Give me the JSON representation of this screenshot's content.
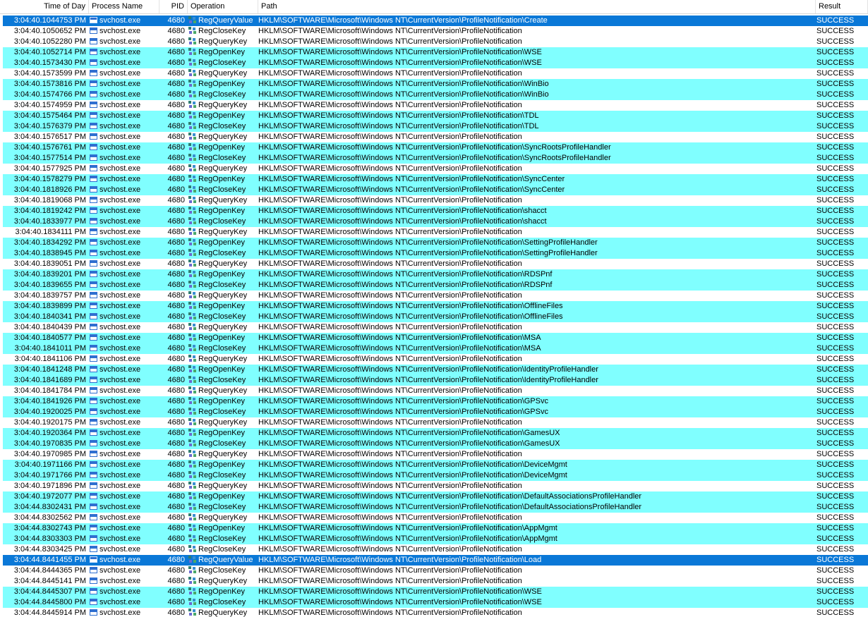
{
  "columns": [
    "Time of Day",
    "Process Name",
    "PID",
    "Operation",
    "Path",
    "Result"
  ],
  "rows": [
    {
      "time": "3:04:40.1044753 PM",
      "proc": "svchost.exe",
      "pid": "4680",
      "op": "RegQueryValue",
      "path": "HKLM\\SOFTWARE\\Microsoft\\Windows NT\\CurrentVersion\\ProfileNotification\\Create",
      "result": "SUCCESS",
      "style": "sel"
    },
    {
      "time": "3:04:40.1050652 PM",
      "proc": "svchost.exe",
      "pid": "4680",
      "op": "RegCloseKey",
      "path": "HKLM\\SOFTWARE\\Microsoft\\Windows NT\\CurrentVersion\\ProfileNotification",
      "result": "SUCCESS",
      "style": "white"
    },
    {
      "time": "3:04:40.1052280 PM",
      "proc": "svchost.exe",
      "pid": "4680",
      "op": "RegQueryKey",
      "path": "HKLM\\SOFTWARE\\Microsoft\\Windows NT\\CurrentVersion\\ProfileNotification",
      "result": "SUCCESS",
      "style": "white"
    },
    {
      "time": "3:04:40.1052714 PM",
      "proc": "svchost.exe",
      "pid": "4680",
      "op": "RegOpenKey",
      "path": "HKLM\\SOFTWARE\\Microsoft\\Windows NT\\CurrentVersion\\ProfileNotification\\WSE",
      "result": "SUCCESS",
      "style": "alt"
    },
    {
      "time": "3:04:40.1573430 PM",
      "proc": "svchost.exe",
      "pid": "4680",
      "op": "RegCloseKey",
      "path": "HKLM\\SOFTWARE\\Microsoft\\Windows NT\\CurrentVersion\\ProfileNotification\\WSE",
      "result": "SUCCESS",
      "style": "alt"
    },
    {
      "time": "3:04:40.1573599 PM",
      "proc": "svchost.exe",
      "pid": "4680",
      "op": "RegQueryKey",
      "path": "HKLM\\SOFTWARE\\Microsoft\\Windows NT\\CurrentVersion\\ProfileNotification",
      "result": "SUCCESS",
      "style": "white"
    },
    {
      "time": "3:04:40.1573816 PM",
      "proc": "svchost.exe",
      "pid": "4680",
      "op": "RegOpenKey",
      "path": "HKLM\\SOFTWARE\\Microsoft\\Windows NT\\CurrentVersion\\ProfileNotification\\WinBio",
      "result": "SUCCESS",
      "style": "alt"
    },
    {
      "time": "3:04:40.1574766 PM",
      "proc": "svchost.exe",
      "pid": "4680",
      "op": "RegCloseKey",
      "path": "HKLM\\SOFTWARE\\Microsoft\\Windows NT\\CurrentVersion\\ProfileNotification\\WinBio",
      "result": "SUCCESS",
      "style": "alt"
    },
    {
      "time": "3:04:40.1574959 PM",
      "proc": "svchost.exe",
      "pid": "4680",
      "op": "RegQueryKey",
      "path": "HKLM\\SOFTWARE\\Microsoft\\Windows NT\\CurrentVersion\\ProfileNotification",
      "result": "SUCCESS",
      "style": "white"
    },
    {
      "time": "3:04:40.1575464 PM",
      "proc": "svchost.exe",
      "pid": "4680",
      "op": "RegOpenKey",
      "path": "HKLM\\SOFTWARE\\Microsoft\\Windows NT\\CurrentVersion\\ProfileNotification\\TDL",
      "result": "SUCCESS",
      "style": "alt"
    },
    {
      "time": "3:04:40.1576379 PM",
      "proc": "svchost.exe",
      "pid": "4680",
      "op": "RegCloseKey",
      "path": "HKLM\\SOFTWARE\\Microsoft\\Windows NT\\CurrentVersion\\ProfileNotification\\TDL",
      "result": "SUCCESS",
      "style": "alt"
    },
    {
      "time": "3:04:40.1576517 PM",
      "proc": "svchost.exe",
      "pid": "4680",
      "op": "RegQueryKey",
      "path": "HKLM\\SOFTWARE\\Microsoft\\Windows NT\\CurrentVersion\\ProfileNotification",
      "result": "SUCCESS",
      "style": "white"
    },
    {
      "time": "3:04:40.1576761 PM",
      "proc": "svchost.exe",
      "pid": "4680",
      "op": "RegOpenKey",
      "path": "HKLM\\SOFTWARE\\Microsoft\\Windows NT\\CurrentVersion\\ProfileNotification\\SyncRootsProfileHandler",
      "result": "SUCCESS",
      "style": "alt"
    },
    {
      "time": "3:04:40.1577514 PM",
      "proc": "svchost.exe",
      "pid": "4680",
      "op": "RegCloseKey",
      "path": "HKLM\\SOFTWARE\\Microsoft\\Windows NT\\CurrentVersion\\ProfileNotification\\SyncRootsProfileHandler",
      "result": "SUCCESS",
      "style": "alt"
    },
    {
      "time": "3:04:40.1577925 PM",
      "proc": "svchost.exe",
      "pid": "4680",
      "op": "RegQueryKey",
      "path": "HKLM\\SOFTWARE\\Microsoft\\Windows NT\\CurrentVersion\\ProfileNotification",
      "result": "SUCCESS",
      "style": "white"
    },
    {
      "time": "3:04:40.1578279 PM",
      "proc": "svchost.exe",
      "pid": "4680",
      "op": "RegOpenKey",
      "path": "HKLM\\SOFTWARE\\Microsoft\\Windows NT\\CurrentVersion\\ProfileNotification\\SyncCenter",
      "result": "SUCCESS",
      "style": "alt"
    },
    {
      "time": "3:04:40.1818926 PM",
      "proc": "svchost.exe",
      "pid": "4680",
      "op": "RegCloseKey",
      "path": "HKLM\\SOFTWARE\\Microsoft\\Windows NT\\CurrentVersion\\ProfileNotification\\SyncCenter",
      "result": "SUCCESS",
      "style": "alt"
    },
    {
      "time": "3:04:40.1819068 PM",
      "proc": "svchost.exe",
      "pid": "4680",
      "op": "RegQueryKey",
      "path": "HKLM\\SOFTWARE\\Microsoft\\Windows NT\\CurrentVersion\\ProfileNotification",
      "result": "SUCCESS",
      "style": "white"
    },
    {
      "time": "3:04:40.1819242 PM",
      "proc": "svchost.exe",
      "pid": "4680",
      "op": "RegOpenKey",
      "path": "HKLM\\SOFTWARE\\Microsoft\\Windows NT\\CurrentVersion\\ProfileNotification\\shacct",
      "result": "SUCCESS",
      "style": "alt"
    },
    {
      "time": "3:04:40.1833977 PM",
      "proc": "svchost.exe",
      "pid": "4680",
      "op": "RegCloseKey",
      "path": "HKLM\\SOFTWARE\\Microsoft\\Windows NT\\CurrentVersion\\ProfileNotification\\shacct",
      "result": "SUCCESS",
      "style": "alt"
    },
    {
      "time": "3:04:40.1834111 PM",
      "proc": "svchost.exe",
      "pid": "4680",
      "op": "RegQueryKey",
      "path": "HKLM\\SOFTWARE\\Microsoft\\Windows NT\\CurrentVersion\\ProfileNotification",
      "result": "SUCCESS",
      "style": "white"
    },
    {
      "time": "3:04:40.1834292 PM",
      "proc": "svchost.exe",
      "pid": "4680",
      "op": "RegOpenKey",
      "path": "HKLM\\SOFTWARE\\Microsoft\\Windows NT\\CurrentVersion\\ProfileNotification\\SettingProfileHandler",
      "result": "SUCCESS",
      "style": "alt"
    },
    {
      "time": "3:04:40.1838945 PM",
      "proc": "svchost.exe",
      "pid": "4680",
      "op": "RegCloseKey",
      "path": "HKLM\\SOFTWARE\\Microsoft\\Windows NT\\CurrentVersion\\ProfileNotification\\SettingProfileHandler",
      "result": "SUCCESS",
      "style": "alt"
    },
    {
      "time": "3:04:40.1839051 PM",
      "proc": "svchost.exe",
      "pid": "4680",
      "op": "RegQueryKey",
      "path": "HKLM\\SOFTWARE\\Microsoft\\Windows NT\\CurrentVersion\\ProfileNotification",
      "result": "SUCCESS",
      "style": "white"
    },
    {
      "time": "3:04:40.1839201 PM",
      "proc": "svchost.exe",
      "pid": "4680",
      "op": "RegOpenKey",
      "path": "HKLM\\SOFTWARE\\Microsoft\\Windows NT\\CurrentVersion\\ProfileNotification\\RDSPnf",
      "result": "SUCCESS",
      "style": "alt"
    },
    {
      "time": "3:04:40.1839655 PM",
      "proc": "svchost.exe",
      "pid": "4680",
      "op": "RegCloseKey",
      "path": "HKLM\\SOFTWARE\\Microsoft\\Windows NT\\CurrentVersion\\ProfileNotification\\RDSPnf",
      "result": "SUCCESS",
      "style": "alt"
    },
    {
      "time": "3:04:40.1839757 PM",
      "proc": "svchost.exe",
      "pid": "4680",
      "op": "RegQueryKey",
      "path": "HKLM\\SOFTWARE\\Microsoft\\Windows NT\\CurrentVersion\\ProfileNotification",
      "result": "SUCCESS",
      "style": "white"
    },
    {
      "time": "3:04:40.1839899 PM",
      "proc": "svchost.exe",
      "pid": "4680",
      "op": "RegOpenKey",
      "path": "HKLM\\SOFTWARE\\Microsoft\\Windows NT\\CurrentVersion\\ProfileNotification\\OfflineFiles",
      "result": "SUCCESS",
      "style": "alt"
    },
    {
      "time": "3:04:40.1840341 PM",
      "proc": "svchost.exe",
      "pid": "4680",
      "op": "RegCloseKey",
      "path": "HKLM\\SOFTWARE\\Microsoft\\Windows NT\\CurrentVersion\\ProfileNotification\\OfflineFiles",
      "result": "SUCCESS",
      "style": "alt"
    },
    {
      "time": "3:04:40.1840439 PM",
      "proc": "svchost.exe",
      "pid": "4680",
      "op": "RegQueryKey",
      "path": "HKLM\\SOFTWARE\\Microsoft\\Windows NT\\CurrentVersion\\ProfileNotification",
      "result": "SUCCESS",
      "style": "white"
    },
    {
      "time": "3:04:40.1840577 PM",
      "proc": "svchost.exe",
      "pid": "4680",
      "op": "RegOpenKey",
      "path": "HKLM\\SOFTWARE\\Microsoft\\Windows NT\\CurrentVersion\\ProfileNotification\\MSA",
      "result": "SUCCESS",
      "style": "alt"
    },
    {
      "time": "3:04:40.1841011 PM",
      "proc": "svchost.exe",
      "pid": "4680",
      "op": "RegCloseKey",
      "path": "HKLM\\SOFTWARE\\Microsoft\\Windows NT\\CurrentVersion\\ProfileNotification\\MSA",
      "result": "SUCCESS",
      "style": "alt"
    },
    {
      "time": "3:04:40.1841106 PM",
      "proc": "svchost.exe",
      "pid": "4680",
      "op": "RegQueryKey",
      "path": "HKLM\\SOFTWARE\\Microsoft\\Windows NT\\CurrentVersion\\ProfileNotification",
      "result": "SUCCESS",
      "style": "white"
    },
    {
      "time": "3:04:40.1841248 PM",
      "proc": "svchost.exe",
      "pid": "4680",
      "op": "RegOpenKey",
      "path": "HKLM\\SOFTWARE\\Microsoft\\Windows NT\\CurrentVersion\\ProfileNotification\\IdentityProfileHandler",
      "result": "SUCCESS",
      "style": "alt"
    },
    {
      "time": "3:04:40.1841689 PM",
      "proc": "svchost.exe",
      "pid": "4680",
      "op": "RegCloseKey",
      "path": "HKLM\\SOFTWARE\\Microsoft\\Windows NT\\CurrentVersion\\ProfileNotification\\IdentityProfileHandler",
      "result": "SUCCESS",
      "style": "alt"
    },
    {
      "time": "3:04:40.1841784 PM",
      "proc": "svchost.exe",
      "pid": "4680",
      "op": "RegQueryKey",
      "path": "HKLM\\SOFTWARE\\Microsoft\\Windows NT\\CurrentVersion\\ProfileNotification",
      "result": "SUCCESS",
      "style": "white"
    },
    {
      "time": "3:04:40.1841926 PM",
      "proc": "svchost.exe",
      "pid": "4680",
      "op": "RegOpenKey",
      "path": "HKLM\\SOFTWARE\\Microsoft\\Windows NT\\CurrentVersion\\ProfileNotification\\GPSvc",
      "result": "SUCCESS",
      "style": "alt"
    },
    {
      "time": "3:04:40.1920025 PM",
      "proc": "svchost.exe",
      "pid": "4680",
      "op": "RegCloseKey",
      "path": "HKLM\\SOFTWARE\\Microsoft\\Windows NT\\CurrentVersion\\ProfileNotification\\GPSvc",
      "result": "SUCCESS",
      "style": "alt"
    },
    {
      "time": "3:04:40.1920175 PM",
      "proc": "svchost.exe",
      "pid": "4680",
      "op": "RegQueryKey",
      "path": "HKLM\\SOFTWARE\\Microsoft\\Windows NT\\CurrentVersion\\ProfileNotification",
      "result": "SUCCESS",
      "style": "white"
    },
    {
      "time": "3:04:40.1920364 PM",
      "proc": "svchost.exe",
      "pid": "4680",
      "op": "RegOpenKey",
      "path": "HKLM\\SOFTWARE\\Microsoft\\Windows NT\\CurrentVersion\\ProfileNotification\\GamesUX",
      "result": "SUCCESS",
      "style": "alt"
    },
    {
      "time": "3:04:40.1970835 PM",
      "proc": "svchost.exe",
      "pid": "4680",
      "op": "RegCloseKey",
      "path": "HKLM\\SOFTWARE\\Microsoft\\Windows NT\\CurrentVersion\\ProfileNotification\\GamesUX",
      "result": "SUCCESS",
      "style": "alt"
    },
    {
      "time": "3:04:40.1970985 PM",
      "proc": "svchost.exe",
      "pid": "4680",
      "op": "RegQueryKey",
      "path": "HKLM\\SOFTWARE\\Microsoft\\Windows NT\\CurrentVersion\\ProfileNotification",
      "result": "SUCCESS",
      "style": "white"
    },
    {
      "time": "3:04:40.1971166 PM",
      "proc": "svchost.exe",
      "pid": "4680",
      "op": "RegOpenKey",
      "path": "HKLM\\SOFTWARE\\Microsoft\\Windows NT\\CurrentVersion\\ProfileNotification\\DeviceMgmt",
      "result": "SUCCESS",
      "style": "alt"
    },
    {
      "time": "3:04:40.1971766 PM",
      "proc": "svchost.exe",
      "pid": "4680",
      "op": "RegCloseKey",
      "path": "HKLM\\SOFTWARE\\Microsoft\\Windows NT\\CurrentVersion\\ProfileNotification\\DeviceMgmt",
      "result": "SUCCESS",
      "style": "alt"
    },
    {
      "time": "3:04:40.1971896 PM",
      "proc": "svchost.exe",
      "pid": "4680",
      "op": "RegQueryKey",
      "path": "HKLM\\SOFTWARE\\Microsoft\\Windows NT\\CurrentVersion\\ProfileNotification",
      "result": "SUCCESS",
      "style": "white"
    },
    {
      "time": "3:04:40.1972077 PM",
      "proc": "svchost.exe",
      "pid": "4680",
      "op": "RegOpenKey",
      "path": "HKLM\\SOFTWARE\\Microsoft\\Windows NT\\CurrentVersion\\ProfileNotification\\DefaultAssociationsProfileHandler",
      "result": "SUCCESS",
      "style": "alt"
    },
    {
      "time": "3:04:44.8302431 PM",
      "proc": "svchost.exe",
      "pid": "4680",
      "op": "RegCloseKey",
      "path": "HKLM\\SOFTWARE\\Microsoft\\Windows NT\\CurrentVersion\\ProfileNotification\\DefaultAssociationsProfileHandler",
      "result": "SUCCESS",
      "style": "alt"
    },
    {
      "time": "3:04:44.8302562 PM",
      "proc": "svchost.exe",
      "pid": "4680",
      "op": "RegQueryKey",
      "path": "HKLM\\SOFTWARE\\Microsoft\\Windows NT\\CurrentVersion\\ProfileNotification",
      "result": "SUCCESS",
      "style": "white"
    },
    {
      "time": "3:04:44.8302743 PM",
      "proc": "svchost.exe",
      "pid": "4680",
      "op": "RegOpenKey",
      "path": "HKLM\\SOFTWARE\\Microsoft\\Windows NT\\CurrentVersion\\ProfileNotification\\AppMgmt",
      "result": "SUCCESS",
      "style": "alt"
    },
    {
      "time": "3:04:44.8303303 PM",
      "proc": "svchost.exe",
      "pid": "4680",
      "op": "RegCloseKey",
      "path": "HKLM\\SOFTWARE\\Microsoft\\Windows NT\\CurrentVersion\\ProfileNotification\\AppMgmt",
      "result": "SUCCESS",
      "style": "alt"
    },
    {
      "time": "3:04:44.8303425 PM",
      "proc": "svchost.exe",
      "pid": "4680",
      "op": "RegCloseKey",
      "path": "HKLM\\SOFTWARE\\Microsoft\\Windows NT\\CurrentVersion\\ProfileNotification",
      "result": "SUCCESS",
      "style": "white"
    },
    {
      "time": "3:04:44.8441455 PM",
      "proc": "svchost.exe",
      "pid": "4680",
      "op": "RegQueryValue",
      "path": "HKLM\\SOFTWARE\\Microsoft\\Windows NT\\CurrentVersion\\ProfileNotification\\Load",
      "result": "SUCCESS",
      "style": "sel"
    },
    {
      "time": "3:04:44.8444365 PM",
      "proc": "svchost.exe",
      "pid": "4680",
      "op": "RegCloseKey",
      "path": "HKLM\\SOFTWARE\\Microsoft\\Windows NT\\CurrentVersion\\ProfileNotification",
      "result": "SUCCESS",
      "style": "white"
    },
    {
      "time": "3:04:44.8445141 PM",
      "proc": "svchost.exe",
      "pid": "4680",
      "op": "RegQueryKey",
      "path": "HKLM\\SOFTWARE\\Microsoft\\Windows NT\\CurrentVersion\\ProfileNotification",
      "result": "SUCCESS",
      "style": "white"
    },
    {
      "time": "3:04:44.8445307 PM",
      "proc": "svchost.exe",
      "pid": "4680",
      "op": "RegOpenKey",
      "path": "HKLM\\SOFTWARE\\Microsoft\\Windows NT\\CurrentVersion\\ProfileNotification\\WSE",
      "result": "SUCCESS",
      "style": "alt"
    },
    {
      "time": "3:04:44.8445800 PM",
      "proc": "svchost.exe",
      "pid": "4680",
      "op": "RegCloseKey",
      "path": "HKLM\\SOFTWARE\\Microsoft\\Windows NT\\CurrentVersion\\ProfileNotification\\WSE",
      "result": "SUCCESS",
      "style": "alt"
    },
    {
      "time": "3:04:44.8445914 PM",
      "proc": "svchost.exe",
      "pid": "4680",
      "op": "RegQueryKey",
      "path": "HKLM\\SOFTWARE\\Microsoft\\Windows NT\\CurrentVersion\\ProfileNotification",
      "result": "SUCCESS",
      "style": "white"
    }
  ],
  "icons": {
    "process": "svchost-process-icon",
    "operation": "registry-icon"
  }
}
